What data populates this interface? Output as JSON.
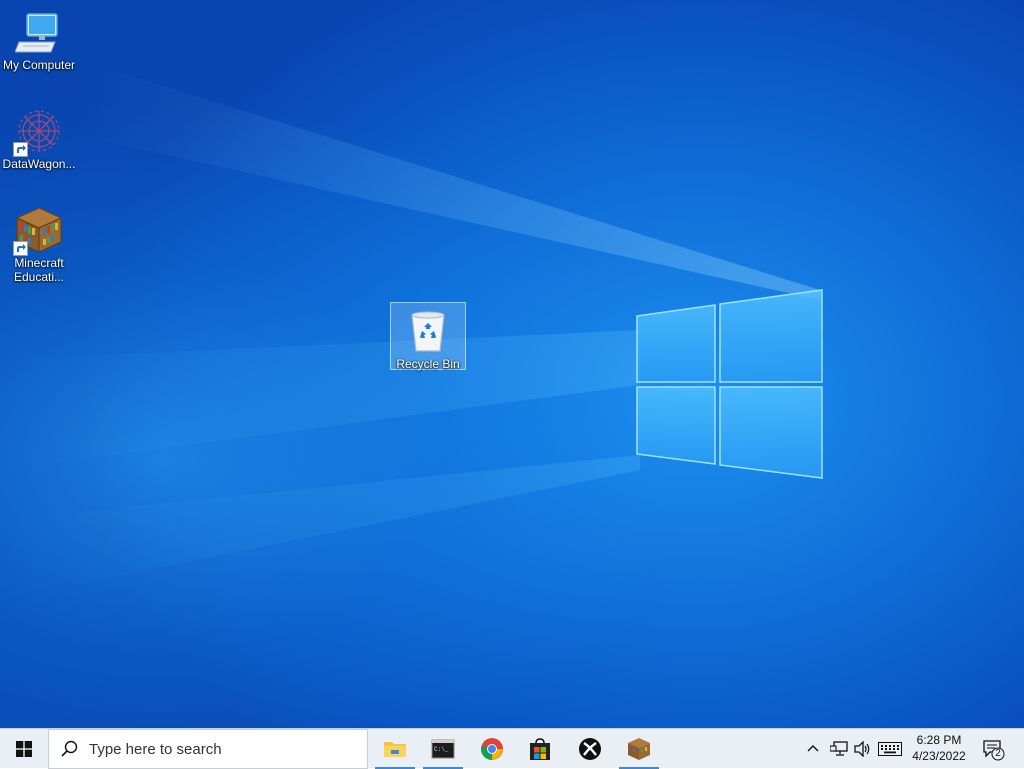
{
  "desktop": {
    "icons": [
      {
        "label": "My Computer",
        "icon": "monitor-icon"
      },
      {
        "label": "DataWagon...",
        "icon": "datawagon-icon"
      },
      {
        "label": "Minecraft Educati...",
        "icon": "minecraft-bookshelf-icon"
      },
      {
        "label": "Recycle Bin",
        "icon": "recycle-bin-icon",
        "selected": true
      }
    ]
  },
  "taskbar": {
    "start_icon": "windows-logo-icon",
    "search": {
      "placeholder": "Type here to search",
      "icon": "search-icon"
    },
    "pinned_apps": [
      {
        "name": "File Explorer",
        "icon": "folder-icon",
        "running": true
      },
      {
        "name": "Command Prompt",
        "icon": "terminal-icon",
        "running": true
      },
      {
        "name": "Google Chrome",
        "icon": "chrome-icon",
        "running": false
      },
      {
        "name": "Microsoft Store",
        "icon": "store-icon",
        "running": false
      },
      {
        "name": "Xbox",
        "icon": "xbox-icon",
        "running": false
      },
      {
        "name": "Minecraft Education",
        "icon": "minecraft-icon",
        "running": true
      }
    ],
    "tray": {
      "icons": [
        "chevron-up-icon",
        "network-icon",
        "volume-icon",
        "keyboard-icon"
      ],
      "time": "6:28 PM",
      "date": "4/23/2022",
      "notification_count": "2"
    }
  },
  "colors": {
    "desktop_blue": "#0f6fd8",
    "taskbar_bg": "#e9eff5",
    "running_indicator": "#3f88d6"
  }
}
